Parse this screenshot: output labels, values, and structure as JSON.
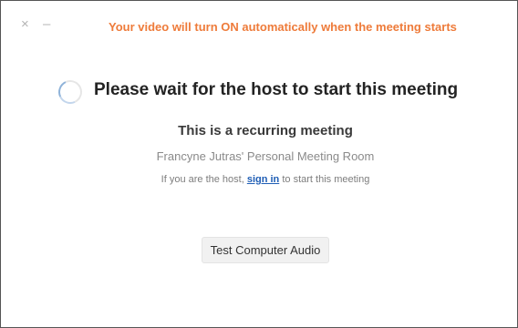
{
  "window": {
    "close_glyph": "×",
    "minimize_glyph": "–",
    "notice": "Your video will turn ON automatically when the meeting starts"
  },
  "main": {
    "headline": "Please wait for the host to start this meeting",
    "recurring_label": "This is a recurring meeting",
    "room_name": "Francyne Jutras' Personal Meeting Room",
    "host_prefix": "If you are the host, ",
    "sign_in_link": "sign in",
    "host_suffix": " to start this meeting",
    "test_audio_button": "Test Computer Audio"
  },
  "colors": {
    "notice": "#ee7b3a",
    "link": "#1f5eb5"
  },
  "icons": {
    "close": "close-icon",
    "minimize": "minimize-icon",
    "spinner": "loading-spinner-icon"
  }
}
